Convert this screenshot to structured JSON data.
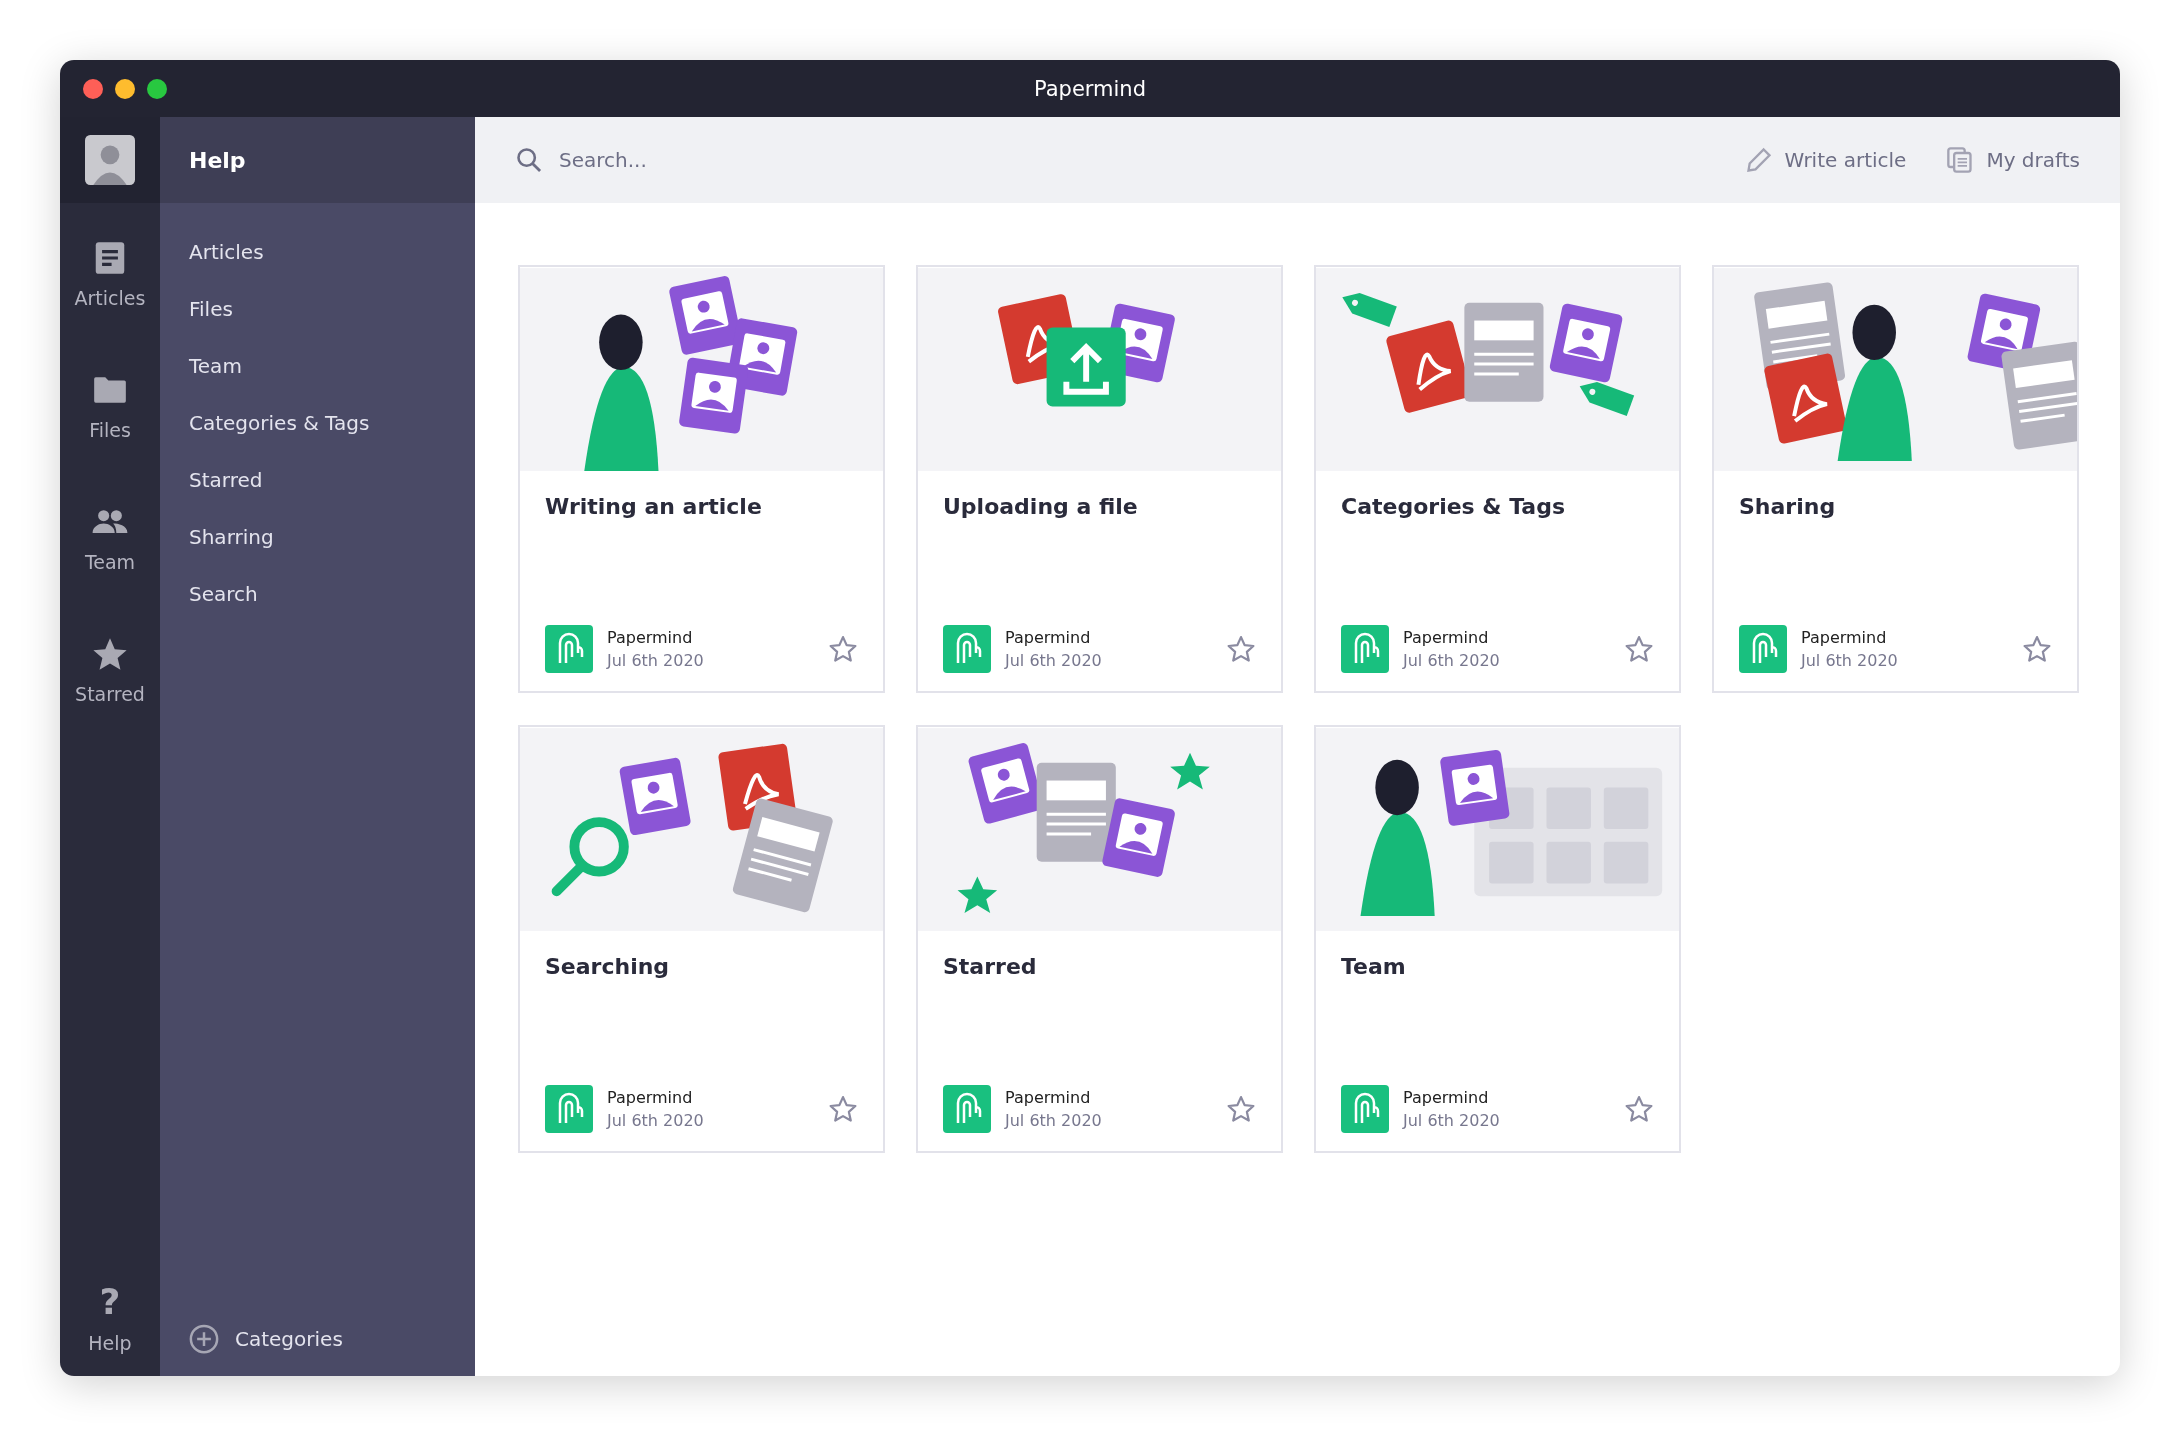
{
  "window": {
    "title": "Papermind"
  },
  "rail": {
    "items": [
      {
        "label": "Articles",
        "kind": "articles"
      },
      {
        "label": "Files",
        "kind": "files"
      },
      {
        "label": "Team",
        "kind": "team"
      },
      {
        "label": "Starred",
        "kind": "starred"
      }
    ],
    "help": {
      "glyph": "?",
      "label": "Help"
    }
  },
  "sidebar": {
    "title": "Help",
    "items": [
      "Articles",
      "Files",
      "Team",
      "Categories & Tags",
      "Starred",
      "Sharring",
      "Search"
    ],
    "footer": "Categories"
  },
  "toolbar": {
    "search": {
      "placeholder": "Search..."
    },
    "actions": [
      {
        "label": "Write article",
        "kind": "write"
      },
      {
        "label": "My drafts",
        "kind": "drafts"
      }
    ]
  },
  "cards": [
    {
      "title": "Writing an article",
      "kind": "writing",
      "author": "Papermind",
      "date": "Jul 6th 2020",
      "starred": false
    },
    {
      "title": "Uploading a file",
      "kind": "upload",
      "author": "Papermind",
      "date": "Jul 6th 2020",
      "starred": false
    },
    {
      "title": "Categories & Tags",
      "kind": "tags",
      "author": "Papermind",
      "date": "Jul 6th 2020",
      "starred": false
    },
    {
      "title": "Sharing",
      "kind": "sharing",
      "author": "Papermind",
      "date": "Jul 6th 2020",
      "starred": false
    },
    {
      "title": "Searching",
      "kind": "search",
      "author": "Papermind",
      "date": "Jul 6th 2020",
      "starred": false
    },
    {
      "title": "Starred",
      "kind": "starred",
      "author": "Papermind",
      "date": "Jul 6th 2020",
      "starred": false
    },
    {
      "title": "Team",
      "kind": "team",
      "author": "Papermind",
      "date": "Jul 6th 2020",
      "starred": false
    }
  ]
}
